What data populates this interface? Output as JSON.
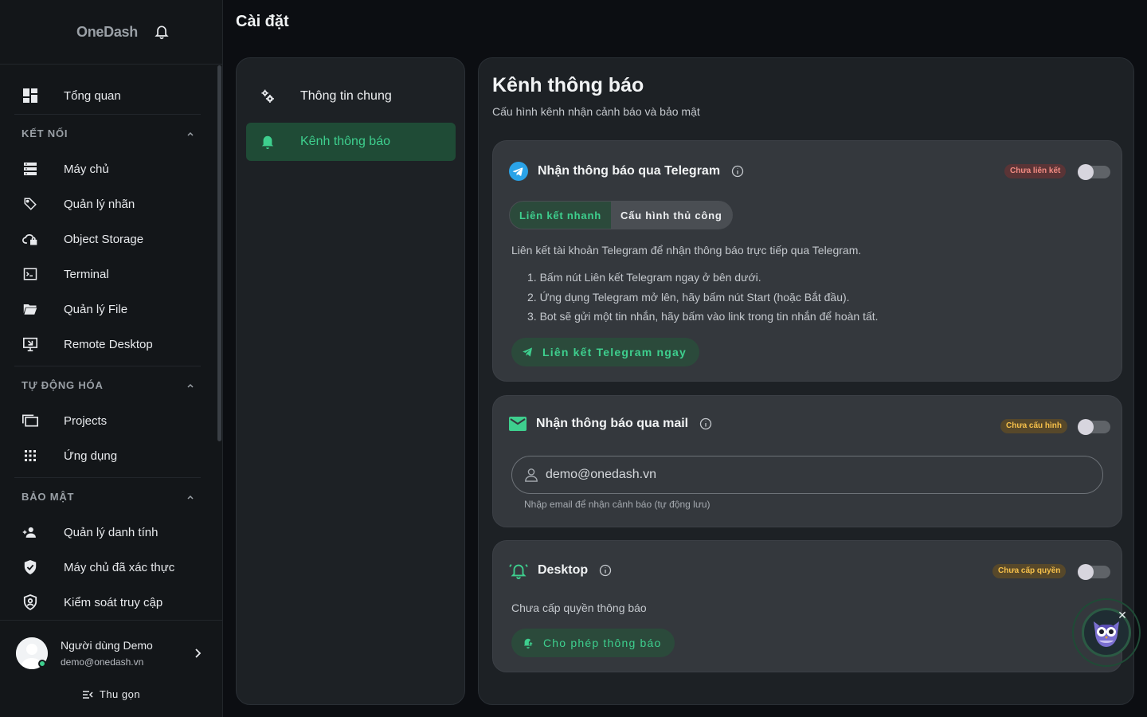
{
  "app": {
    "brand": "OneDash",
    "page_title": "Cài đặt"
  },
  "sidebar": {
    "top_item": {
      "label": "Tổng quan",
      "icon": "dashboard-icon"
    },
    "sections": [
      {
        "title": "KẾT NỐI",
        "items": [
          {
            "label": "Máy chủ",
            "icon": "server-icon"
          },
          {
            "label": "Quản lý nhãn",
            "icon": "tag-icon"
          },
          {
            "label": "Object Storage",
            "icon": "cloud-lock-icon"
          },
          {
            "label": "Terminal",
            "icon": "terminal-icon"
          },
          {
            "label": "Quản lý File",
            "icon": "folder-icon"
          },
          {
            "label": "Remote Desktop",
            "icon": "remote-desktop-icon"
          }
        ]
      },
      {
        "title": "TỰ ĐỘNG HÓA",
        "items": [
          {
            "label": "Projects",
            "icon": "projects-icon"
          },
          {
            "label": "Ứng dụng",
            "icon": "apps-grid-icon"
          }
        ]
      },
      {
        "title": "BẢO MẬT",
        "items": [
          {
            "label": "Quản lý danh tính",
            "icon": "identity-icon"
          },
          {
            "label": "Máy chủ đã xác thực",
            "icon": "shield-check-icon"
          },
          {
            "label": "Kiểm soát truy cập",
            "icon": "access-control-icon"
          }
        ]
      }
    ],
    "user": {
      "name": "Người dùng Demo",
      "email": "demo@onedash.vn"
    },
    "collapse_label": "Thu gọn"
  },
  "settings_menu": {
    "items": [
      {
        "label": "Thông tin chung",
        "icon": "gears-icon",
        "active": false
      },
      {
        "label": "Kênh thông báo",
        "icon": "bell-icon",
        "active": true
      }
    ]
  },
  "content": {
    "title": "Kênh thông báo",
    "subtitle": "Cấu hình kênh nhận cảnh báo và bảo mật",
    "telegram": {
      "title": "Nhận thông báo qua Telegram",
      "badge": "Chưa liên kết",
      "enabled": false,
      "tabs": [
        "Liên kết nhanh",
        "Cấu hình thủ công"
      ],
      "active_tab": 0,
      "description": "Liên kết tài khoản Telegram để nhận thông báo trực tiếp qua Telegram.",
      "steps": [
        "1. Bấm nút Liên kết Telegram ngay ở bên dưới.",
        "2. Ứng dụng Telegram mở lên, hãy bấm nút Start (hoặc Bắt đầu).",
        "3. Bot sẽ gửi một tin nhắn, hãy bấm vào link trong tin nhắn để hoàn tất."
      ],
      "button": "Liên kết Telegram ngay"
    },
    "mail": {
      "title": "Nhận thông báo qua mail",
      "badge": "Chưa cấu hình",
      "enabled": false,
      "email_value": "demo@onedash.vn",
      "hint": "Nhập email để nhận cảnh báo (tự động lưu)"
    },
    "desktop": {
      "title": "Desktop",
      "badge": "Chưa cấp quyền",
      "enabled": false,
      "status": "Chưa cấp quyền thông báo",
      "button": "Cho phép thông báo"
    }
  },
  "colors": {
    "accent_green": "#3ecf8e",
    "active_bg": "#1f4b36",
    "badge_red": "#f28b82",
    "badge_yellow": "#f6c04a",
    "telegram_blue": "#2aa3e8"
  }
}
